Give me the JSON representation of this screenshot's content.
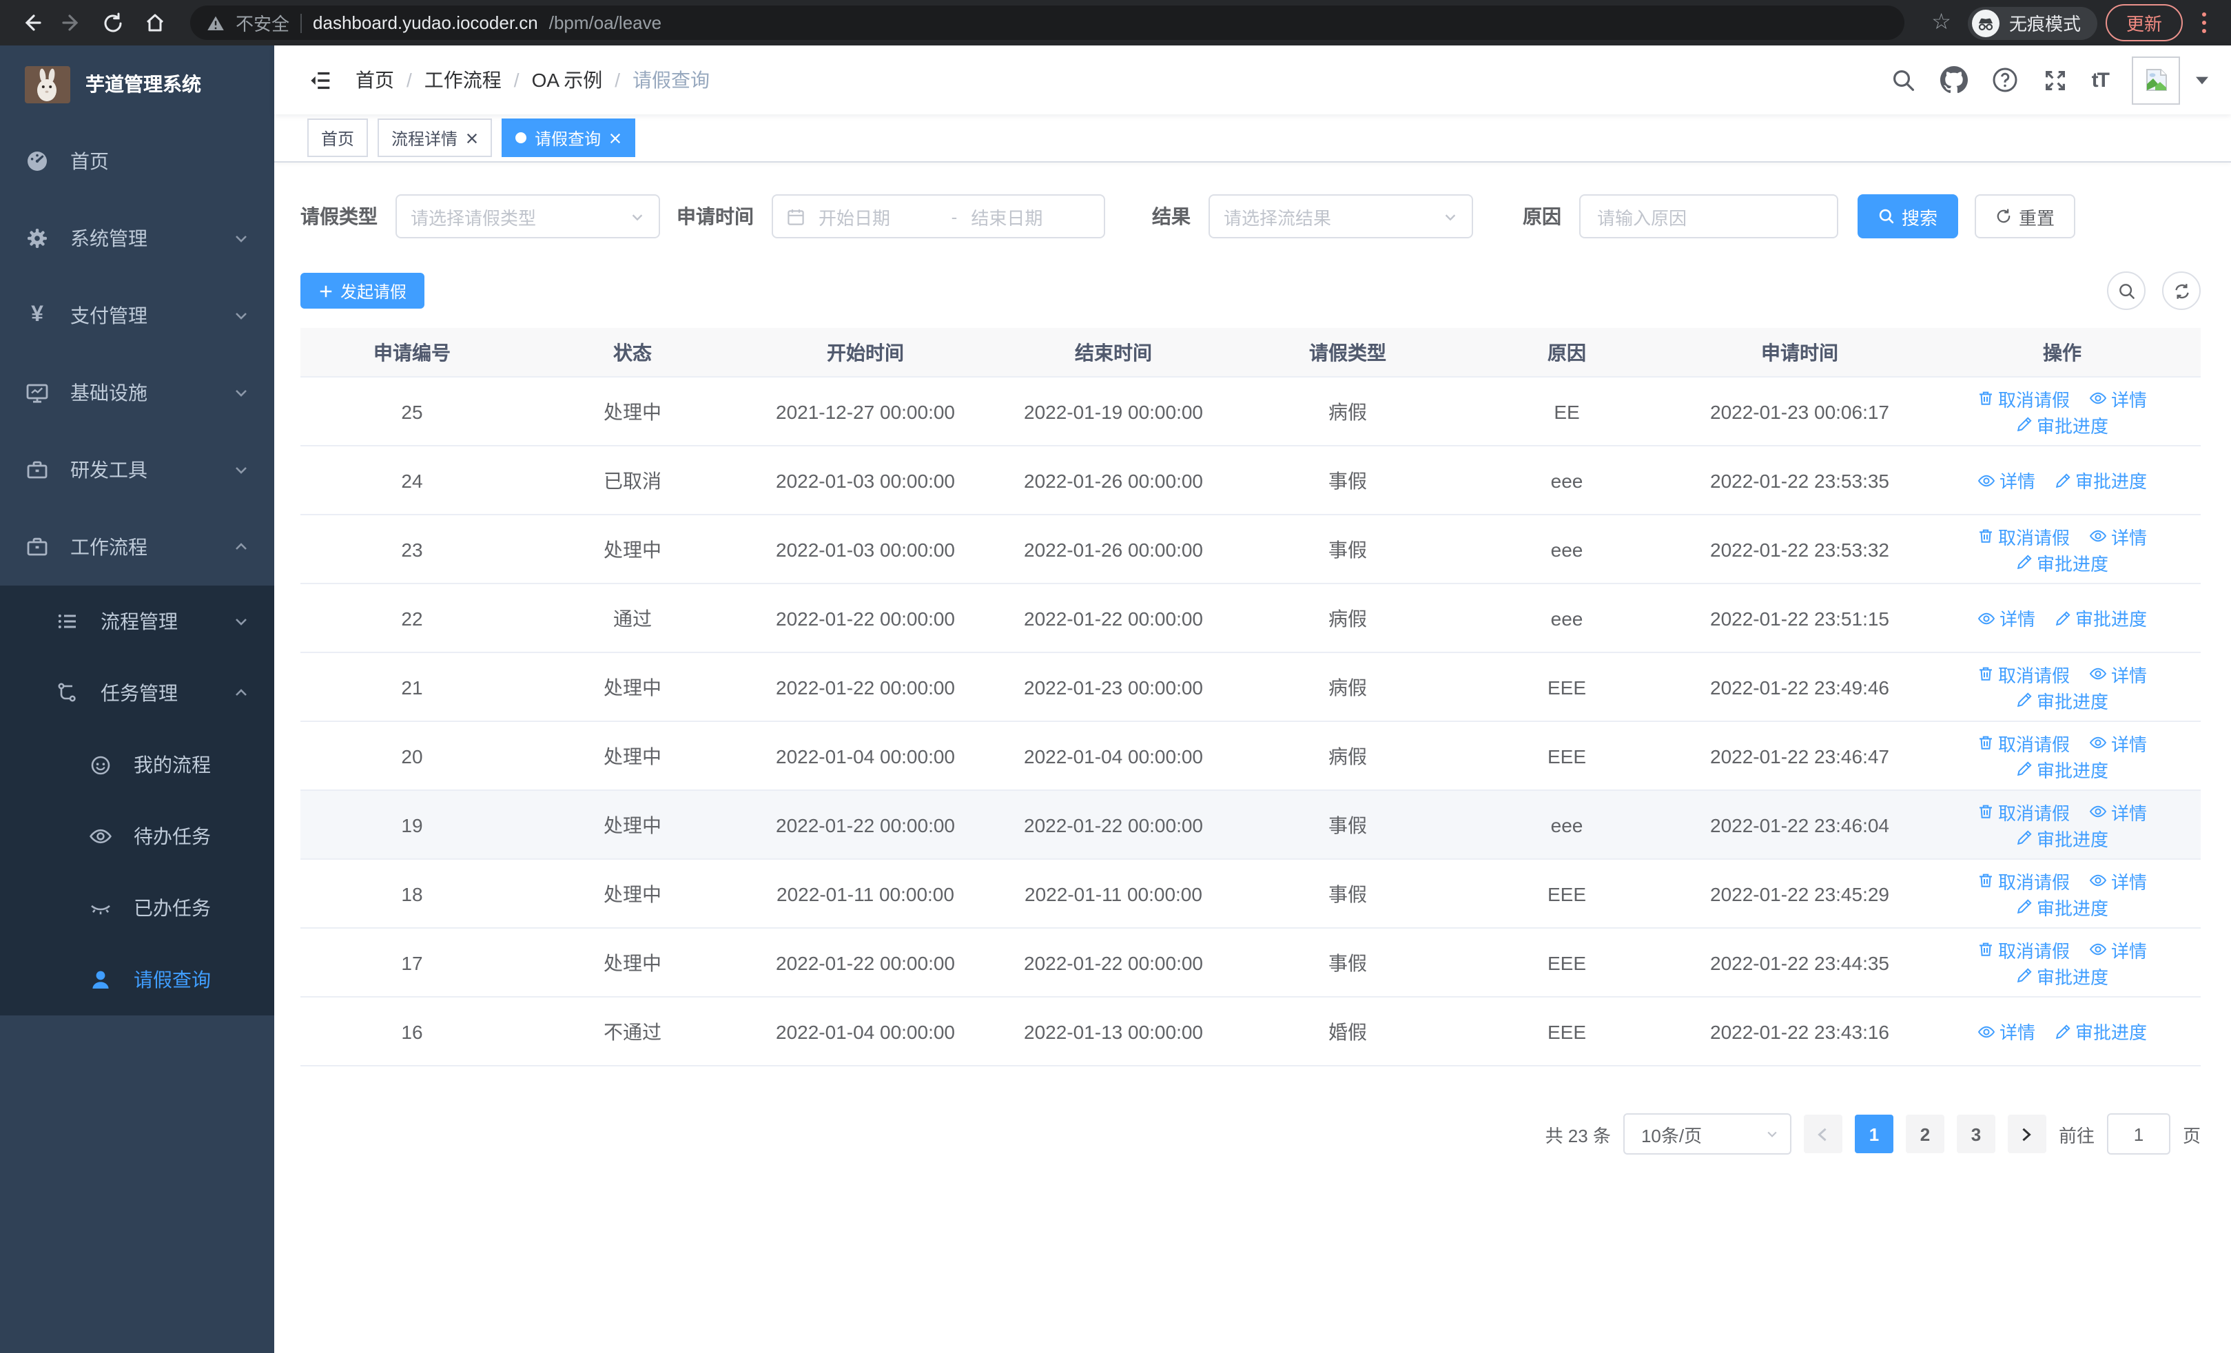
{
  "browser": {
    "security_label": "不安全",
    "url_host": "dashboard.yudao.iocoder.cn",
    "url_path": "/bpm/oa/leave",
    "incognito_label": "无痕模式",
    "update_label": "更新"
  },
  "sidebar": {
    "app_title": "芋道管理系统",
    "items": [
      {
        "label": "首页"
      },
      {
        "label": "系统管理"
      },
      {
        "label": "支付管理"
      },
      {
        "label": "基础设施"
      },
      {
        "label": "研发工具"
      },
      {
        "label": "工作流程"
      }
    ],
    "workflow_children": [
      {
        "label": "流程管理"
      },
      {
        "label": "任务管理"
      }
    ],
    "task_children": [
      {
        "label": "我的流程"
      },
      {
        "label": "待办任务"
      },
      {
        "label": "已办任务"
      },
      {
        "label": "请假查询"
      }
    ]
  },
  "header": {
    "breadcrumb": [
      "首页",
      "工作流程",
      "OA 示例",
      "请假查询"
    ],
    "breadcrumb_separator": "/",
    "fontsize_label": "tT"
  },
  "tabs": [
    {
      "label": "首页",
      "closable": false,
      "active": false
    },
    {
      "label": "流程详情",
      "closable": true,
      "active": false
    },
    {
      "label": "请假查询",
      "closable": true,
      "active": true
    }
  ],
  "filters": {
    "leave_type_label": "请假类型",
    "leave_type_placeholder": "请选择请假类型",
    "apply_time_label": "申请时间",
    "start_date_placeholder": "开始日期",
    "date_separator": "-",
    "end_date_placeholder": "结束日期",
    "result_label": "结果",
    "result_placeholder": "请选择流结果",
    "reason_label": "原因",
    "reason_placeholder": "请输入原因",
    "search_label": "搜索",
    "reset_label": "重置"
  },
  "toolbar": {
    "create_label": "发起请假"
  },
  "table": {
    "columns": [
      "申请编号",
      "状态",
      "开始时间",
      "结束时间",
      "请假类型",
      "原因",
      "申请时间",
      "操作"
    ],
    "action_labels": {
      "cancel": "取消请假",
      "detail": "详情",
      "progress": "审批进度"
    },
    "rows": [
      {
        "id": "25",
        "status": "处理中",
        "start": "2021-12-27 00:00:00",
        "end": "2022-01-19 00:00:00",
        "type": "病假",
        "reason": "EE",
        "applied": "2022-01-23 00:06:17",
        "actions": [
          "cancel",
          "detail",
          "progress"
        ],
        "highlight": false
      },
      {
        "id": "24",
        "status": "已取消",
        "start": "2022-01-03 00:00:00",
        "end": "2022-01-26 00:00:00",
        "type": "事假",
        "reason": "eee",
        "applied": "2022-01-22 23:53:35",
        "actions": [
          "detail",
          "progress"
        ],
        "highlight": false
      },
      {
        "id": "23",
        "status": "处理中",
        "start": "2022-01-03 00:00:00",
        "end": "2022-01-26 00:00:00",
        "type": "事假",
        "reason": "eee",
        "applied": "2022-01-22 23:53:32",
        "actions": [
          "cancel",
          "detail",
          "progress"
        ],
        "highlight": false
      },
      {
        "id": "22",
        "status": "通过",
        "start": "2022-01-22 00:00:00",
        "end": "2022-01-22 00:00:00",
        "type": "病假",
        "reason": "eee",
        "applied": "2022-01-22 23:51:15",
        "actions": [
          "detail",
          "progress"
        ],
        "highlight": false
      },
      {
        "id": "21",
        "status": "处理中",
        "start": "2022-01-22 00:00:00",
        "end": "2022-01-23 00:00:00",
        "type": "病假",
        "reason": "EEE",
        "applied": "2022-01-22 23:49:46",
        "actions": [
          "cancel",
          "detail",
          "progress"
        ],
        "highlight": false
      },
      {
        "id": "20",
        "status": "处理中",
        "start": "2022-01-04 00:00:00",
        "end": "2022-01-04 00:00:00",
        "type": "病假",
        "reason": "EEE",
        "applied": "2022-01-22 23:46:47",
        "actions": [
          "cancel",
          "detail",
          "progress"
        ],
        "highlight": false
      },
      {
        "id": "19",
        "status": "处理中",
        "start": "2022-01-22 00:00:00",
        "end": "2022-01-22 00:00:00",
        "type": "事假",
        "reason": "eee",
        "applied": "2022-01-22 23:46:04",
        "actions": [
          "cancel",
          "detail",
          "progress"
        ],
        "highlight": true
      },
      {
        "id": "18",
        "status": "处理中",
        "start": "2022-01-11 00:00:00",
        "end": "2022-01-11 00:00:00",
        "type": "事假",
        "reason": "EEE",
        "applied": "2022-01-22 23:45:29",
        "actions": [
          "cancel",
          "detail",
          "progress"
        ],
        "highlight": false
      },
      {
        "id": "17",
        "status": "处理中",
        "start": "2022-01-22 00:00:00",
        "end": "2022-01-22 00:00:00",
        "type": "事假",
        "reason": "EEE",
        "applied": "2022-01-22 23:44:35",
        "actions": [
          "cancel",
          "detail",
          "progress"
        ],
        "highlight": false
      },
      {
        "id": "16",
        "status": "不通过",
        "start": "2022-01-04 00:00:00",
        "end": "2022-01-13 00:00:00",
        "type": "婚假",
        "reason": "EEE",
        "applied": "2022-01-22 23:43:16",
        "actions": [
          "detail",
          "progress"
        ],
        "highlight": false
      }
    ]
  },
  "pagination": {
    "total_label": "共 23 条",
    "page_size": "10条/页",
    "pages": [
      "1",
      "2",
      "3"
    ],
    "active_page": "1",
    "goto_label": "前往",
    "goto_value": "1",
    "page_unit": "页"
  },
  "colors": {
    "primary": "#409eff",
    "sidebar_bg": "#304156",
    "submenu_bg": "#1f2d3d",
    "link_blue": "#409eff"
  }
}
